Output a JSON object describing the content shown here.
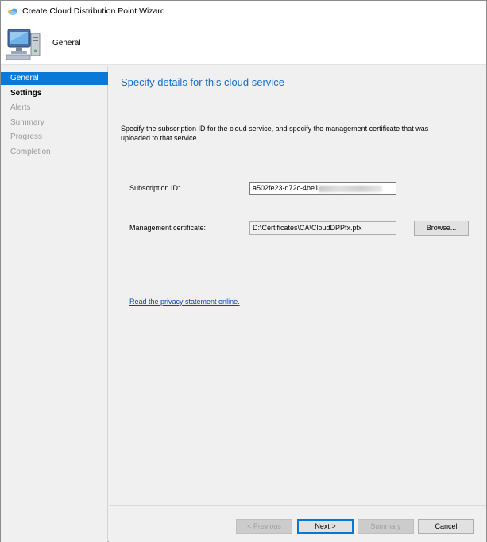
{
  "window": {
    "title": "Create Cloud Distribution Point Wizard"
  },
  "header": {
    "title": "General",
    "icon": "computer-icon"
  },
  "sidebar": {
    "items": [
      {
        "label": "General",
        "state": "active"
      },
      {
        "label": "Settings",
        "state": "bold"
      },
      {
        "label": "Alerts",
        "state": "disabled"
      },
      {
        "label": "Summary",
        "state": "disabled"
      },
      {
        "label": "Progress",
        "state": "disabled"
      },
      {
        "label": "Completion",
        "state": "disabled"
      }
    ]
  },
  "main": {
    "title": "Specify details for this cloud service",
    "description": "Specify the subscription ID for the cloud service, and specify the management certificate that was uploaded to that service.",
    "subscription_label": "Subscription ID:",
    "subscription_value": "a502fe23-d72c-4be1",
    "certificate_label": "Management certificate:",
    "certificate_value": "D:\\Certificates\\CA\\CloudDPPfx.pfx",
    "browse_label": "Browse...",
    "privacy_link": "Read the privacy statement online."
  },
  "footer": {
    "previous_label": "< Previous",
    "next_label": "Next >",
    "summary_label": "Summary",
    "cancel_label": "Cancel"
  },
  "colors": {
    "accent": "#0a78d7",
    "title_blue": "#1b6ec2",
    "link": "#0645ad"
  }
}
